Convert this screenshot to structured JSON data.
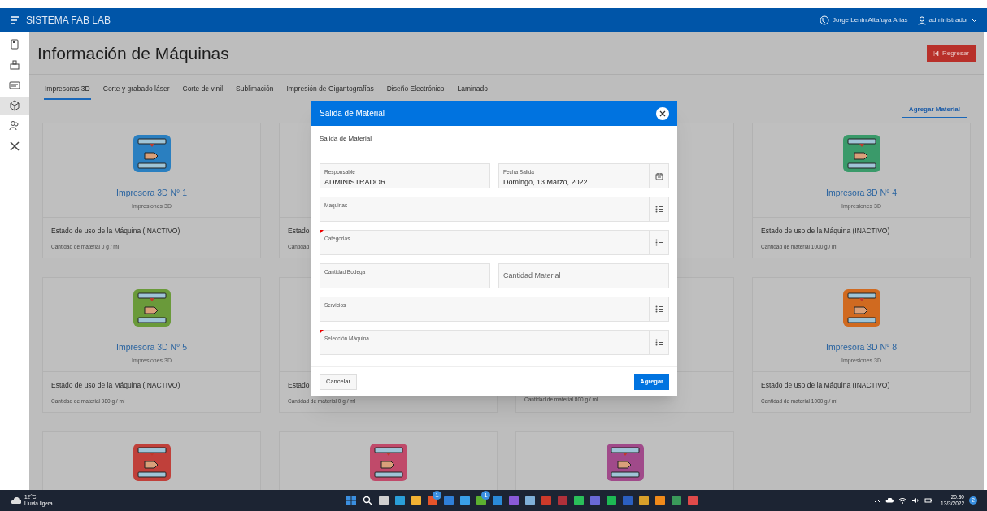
{
  "app_bar": {
    "title": "SISTEMA FAB LAB",
    "user_full_name": "Jorge Lenin Altafuya Arias",
    "user": "administrador"
  },
  "sidebar": {
    "items": [
      {
        "selected": false
      },
      {
        "selected": false
      },
      {
        "selected": false
      },
      {
        "selected": true
      },
      {
        "selected": false
      },
      {
        "selected": false
      }
    ]
  },
  "page": {
    "title": "Información de Máquinas",
    "back_button": "Regresar",
    "add_button": "Agregar Material"
  },
  "tabs": [
    {
      "label": "Impresoras 3D",
      "selected": true
    },
    {
      "label": "Corte y grabado láser",
      "selected": false
    },
    {
      "label": "Corte de vinil",
      "selected": false
    },
    {
      "label": "Sublimación",
      "selected": false
    },
    {
      "label": "Impresión de Gigantografías",
      "selected": false
    },
    {
      "label": "Diseño Electrónico",
      "selected": false
    },
    {
      "label": "Laminado",
      "selected": false
    }
  ],
  "cards": [
    {
      "color": "#2a7fc0",
      "title": "Impresora 3D N° 1",
      "subtitle": "Impresiones 3D",
      "status": "Estado de uso de la Máquina (INACTIVO)",
      "material": "Cantidad de material 0 g / ml"
    },
    {
      "kind": "machine",
      "status": "Estado",
      "material": "Cantidad"
    },
    {
      "kind": "covered"
    },
    {
      "color": "#3a9a6a",
      "title": "Impresora 3D N° 4",
      "subtitle": "Impresiones 3D",
      "status": "Estado de uso de la Máquina (INACTIVO)",
      "material": "Cantidad de material 1000 g / ml"
    },
    {
      "color": "#6a9a3a",
      "title": "Impresora 3D N° 5",
      "subtitle": "Impresiones 3D",
      "status": "Estado de uso de la Máquina (INACTIVO)",
      "material": "Cantidad de material 980 g / ml"
    },
    {
      "status": "Estado",
      "material": "Cantidad de material 0 g / ml"
    },
    {
      "material": "Cantidad de material 800 g / ml"
    },
    {
      "color": "#d06a20",
      "title": "Impresora 3D N° 8",
      "subtitle": "Impresiones 3D",
      "status": "Estado de uso de la Máquina (INACTIVO)",
      "material": "Cantidad de material 1000 g / ml"
    },
    {
      "color": "#c0403a"
    },
    {
      "color": "#c04a6a"
    },
    {
      "color": "#a04a8a"
    }
  ],
  "dialog": {
    "title": "Salida de Material",
    "subtitle": "Salida de Material",
    "rows": [
      [
        {
          "kind": "text",
          "label": "Responsable",
          "value": "ADMINISTRADOR",
          "required": false
        },
        {
          "kind": "date",
          "label": "Fecha Salida",
          "value": "Domingo, 13 Marzo, 2022",
          "required": false
        }
      ],
      [
        {
          "kind": "select",
          "label": "Maquinas",
          "required": false
        }
      ],
      [
        {
          "kind": "select",
          "label": "Categorias",
          "required": true
        }
      ],
      [
        {
          "kind": "text",
          "label": "Cantidad Bodega",
          "required": false
        },
        {
          "kind": "placeholder",
          "placeholder": "Cantidad Material",
          "required": false
        }
      ],
      [
        {
          "kind": "select",
          "label": "Servicios",
          "required": false
        }
      ],
      [
        {
          "kind": "select",
          "label": "Selección Máquina",
          "required": true
        }
      ]
    ],
    "cancel_button": "Cancelar",
    "confirm_button": "Agregar"
  },
  "taskbar": {
    "temperature": "12°C",
    "weather": "Lluvia ligera",
    "app_badges": [
      "1",
      "1"
    ],
    "time": "20:30",
    "date": "13/3/2022",
    "notifications": "2"
  }
}
